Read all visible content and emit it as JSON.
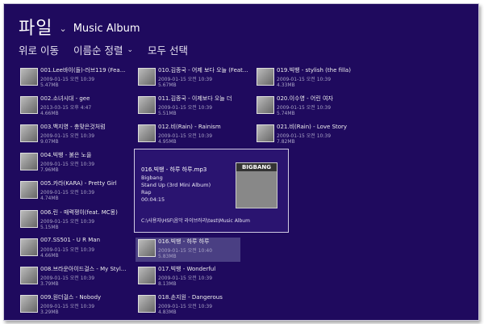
{
  "header": {
    "app_title": "파일",
    "folder": "Music Album"
  },
  "commands": {
    "up": "위로 이동",
    "sort": "이름순 정렬",
    "select_all": "모두 선택"
  },
  "tiles": [
    {
      "name": "001.Lee바이(돌)-러브119 (Fea...",
      "date": "2009-01-15 오전 10:39",
      "size": "5.47MB"
    },
    {
      "name": "002.소녀시대 - gee",
      "date": "2013-03-15 오후 4:47",
      "size": "4.66MB"
    },
    {
      "name": "003.백지영 - 총맞은것처럼",
      "date": "2009-01-15 오전 10:39",
      "size": "9.07MB"
    },
    {
      "name": "004.빅뱅 - 붉은 노을",
      "date": "2009-01-15 오전 10:39",
      "size": "7.96MB"
    },
    {
      "name": "005.카라(KARA) - Pretty Girl",
      "date": "2009-01-15 오전 10:39",
      "size": "4.74MB"
    },
    {
      "name": "006.린 - 매력쟁이(feat. MC몽)",
      "date": "2009-01-15 오전 10:39",
      "size": "5.15MB"
    },
    {
      "name": "007.SS501 - U R Man",
      "date": "2009-01-15 오전 10:39",
      "size": "4.66MB"
    },
    {
      "name": "008.브라운아이드걸스 - My Styl...",
      "date": "2009-01-15 오전 10:39",
      "size": "3.79MB"
    },
    {
      "name": "009.원더걸스 - Nobody",
      "date": "2009-01-15 오전 10:39",
      "size": "3.29MB"
    },
    {
      "name": "010.김종국 - 어제 보다 오늘 (Feat...",
      "date": "2009-01-15 오전 10:39",
      "size": "5.67MB"
    },
    {
      "name": "011.김종국 - 이제보다 오늘 더",
      "date": "2009-01-15 오전 10:39",
      "size": "5.51MB"
    },
    {
      "name": "012.비(Rain) - Rainism",
      "date": "2009-01-15 오전 10:39",
      "size": "4.95MB"
    },
    {
      "name": "016.빅뱅 - 하루 하루",
      "date": "2009-01-15 오전 10:40",
      "size": "5.83MB"
    },
    {
      "name": "017.빅뱅 - Wonderful",
      "date": "2009-01-15 오전 10:39",
      "size": "8.13MB"
    },
    {
      "name": "018.손지원 - Dangerous",
      "date": "2009-01-15 오전 10:39",
      "size": "4.83MB"
    },
    {
      "name": "019.빅뱅 - stylish (the filla)",
      "date": "2009-01-15 오전 10:39",
      "size": "4.33MB"
    },
    {
      "name": "020.이수영 - 어린 여자",
      "date": "2009-01-15 오전 10:39",
      "size": "5.74MB"
    },
    {
      "name": "021.비(Rain) - Love Story",
      "date": "2009-01-15 오전 10:39",
      "size": "7.82MB"
    }
  ],
  "detail": {
    "filename": "016.빅뱅 - 하루 하루.mp3",
    "artist": "Bigbang",
    "album": "Stand Up (3rd Mini Album)",
    "genre": "Rap",
    "duration": "00:04:15",
    "path": "C:\\사용자\\HSF\\음악 라이브러리\\test\\Music Album",
    "thumb_text": "BIGBANG"
  }
}
